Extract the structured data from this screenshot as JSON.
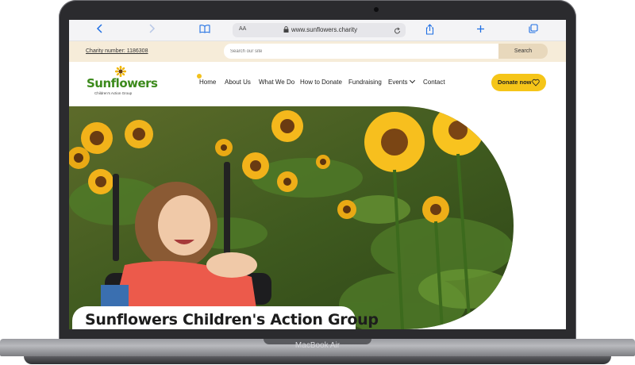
{
  "device": {
    "brand_label": "MacBook Air"
  },
  "browser": {
    "address_aa": "AA",
    "url": "www.sunflowers.charity",
    "icons": [
      "back-icon",
      "forward-icon",
      "book-icon",
      "share-icon",
      "new-tab-icon",
      "tabs-icon",
      "reload-icon",
      "lock-icon"
    ]
  },
  "topbar": {
    "charity_number": "Charity number: 1186308",
    "search_placeholder": "Search our site",
    "search_button": "Search",
    "background": "#f6ecd9"
  },
  "logo": {
    "wordmark": "Sunflowers",
    "tagline": "Children's Action Group"
  },
  "nav": {
    "items": [
      "Home",
      "About Us",
      "What We Do",
      "How to Donate",
      "Fundraising",
      "Events",
      "Contact"
    ],
    "donate": "Donate now",
    "accent": "#f5c518"
  },
  "hero": {
    "title": "Sunflowers Children's Action Group"
  }
}
